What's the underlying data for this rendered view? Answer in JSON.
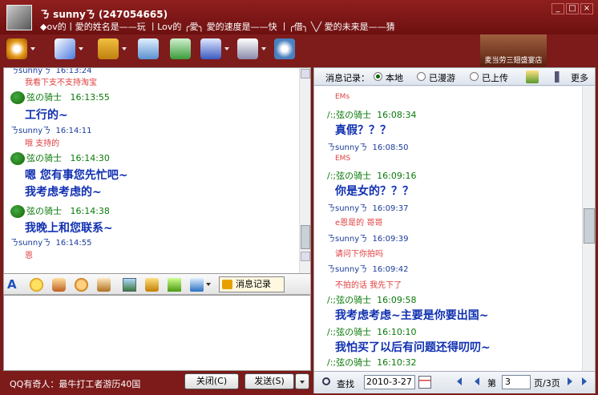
{
  "window": {
    "title": "ㄋ sunnyㄋ (247054665)",
    "status": "◆ov的丨愛的姓名是——玩 丨Lov的 ╭愛╮ 愛的速度是——快 丨╭借╮ ╲╱ 愛的未来是——猜",
    "btn_min": "_",
    "btn_max": "□",
    "btn_close": "×"
  },
  "toolbar": {
    "icons": [
      "video-icon",
      "voice-icon",
      "file-transfer-icon",
      "email-icon",
      "add-icon",
      "app-icon",
      "game-icon",
      "settings-icon"
    ]
  },
  "ad": {
    "text": "麦当劳三翅盛宴店"
  },
  "chat": {
    "messages": [
      {
        "type": "sender",
        "nick": "ㄋsunnyㄋ",
        "time": "16:13:24"
      },
      {
        "type": "plain",
        "text": "我看下支不支持淘宝"
      },
      {
        "type": "sender-icon",
        "nick": "弦の骑士",
        "time": "16:13:55"
      },
      {
        "type": "big",
        "text": "工行的~"
      },
      {
        "type": "sender",
        "nick": "ㄋsunnyㄋ",
        "time": "16:14:11"
      },
      {
        "type": "plain",
        "text": "哦 支持的"
      },
      {
        "type": "sender-icon",
        "nick": "弦の骑士",
        "time": "16:14:30"
      },
      {
        "type": "big",
        "text": "嗯 您有事您先忙吧~"
      },
      {
        "type": "big",
        "text": "我考虑考虑的~"
      },
      {
        "type": "sender-icon",
        "nick": "弦の骑士",
        "time": "16:14:38"
      },
      {
        "type": "big",
        "text": "我晚上和您联系~"
      },
      {
        "type": "sender",
        "nick": "ㄋsunnyㄋ",
        "time": "16:14:55"
      },
      {
        "type": "plain",
        "text": "恩"
      }
    ]
  },
  "format": {
    "record_label": "消息记录"
  },
  "bottom": {
    "ad": "QQ有奇人：最牛打工者游历40国",
    "close": "关闭(C)",
    "send": "发送(S)"
  },
  "history": {
    "header_label": "消息记录：",
    "opt_local": "本地",
    "opt_roam": "已漫游",
    "opt_upload": "已上传",
    "more": "更多",
    "messages": [
      {
        "type": "plain",
        "text": "EMs"
      },
      {
        "type": "sender",
        "nick": "/:;弦の骑士",
        "time": "16:08:34"
      },
      {
        "type": "big",
        "text": "真假？？？"
      },
      {
        "type": "sender",
        "nick": "ㄋsunnyㄋ",
        "time": "16:08:50"
      },
      {
        "type": "plain",
        "text": "EMS"
      },
      {
        "type": "sender",
        "nick": "/:;弦の骑士",
        "time": "16:09:16"
      },
      {
        "type": "big",
        "text": "你是女的？？？"
      },
      {
        "type": "sender",
        "nick": "ㄋsunnyㄋ",
        "time": "16:09:37"
      },
      {
        "type": "plain",
        "text": "e恩是的 哥哥"
      },
      {
        "type": "sender",
        "nick": "ㄋsunnyㄋ",
        "time": "16:09:39"
      },
      {
        "type": "plain",
        "text": "请问下你拍吗"
      },
      {
        "type": "sender",
        "nick": "ㄋsunnyㄋ",
        "time": "16:09:42"
      },
      {
        "type": "plain",
        "text": "不拍的话 我先下了"
      },
      {
        "type": "sender",
        "nick": "/:;弦の骑士",
        "time": "16:09:58"
      },
      {
        "type": "big",
        "text": "我考虑考虑~主要是你要出国~"
      },
      {
        "type": "sender",
        "nick": "/:;弦の骑士",
        "time": "16:10:10"
      },
      {
        "type": "big",
        "text": "我怕买了以后有问题还得叨叨~"
      },
      {
        "type": "sender",
        "nick": "/:;弦の骑士",
        "time": "16:10:32"
      }
    ],
    "search": "查找",
    "date": "2010-3-27",
    "page_label": "第",
    "page": "3",
    "total": "页/3页"
  }
}
